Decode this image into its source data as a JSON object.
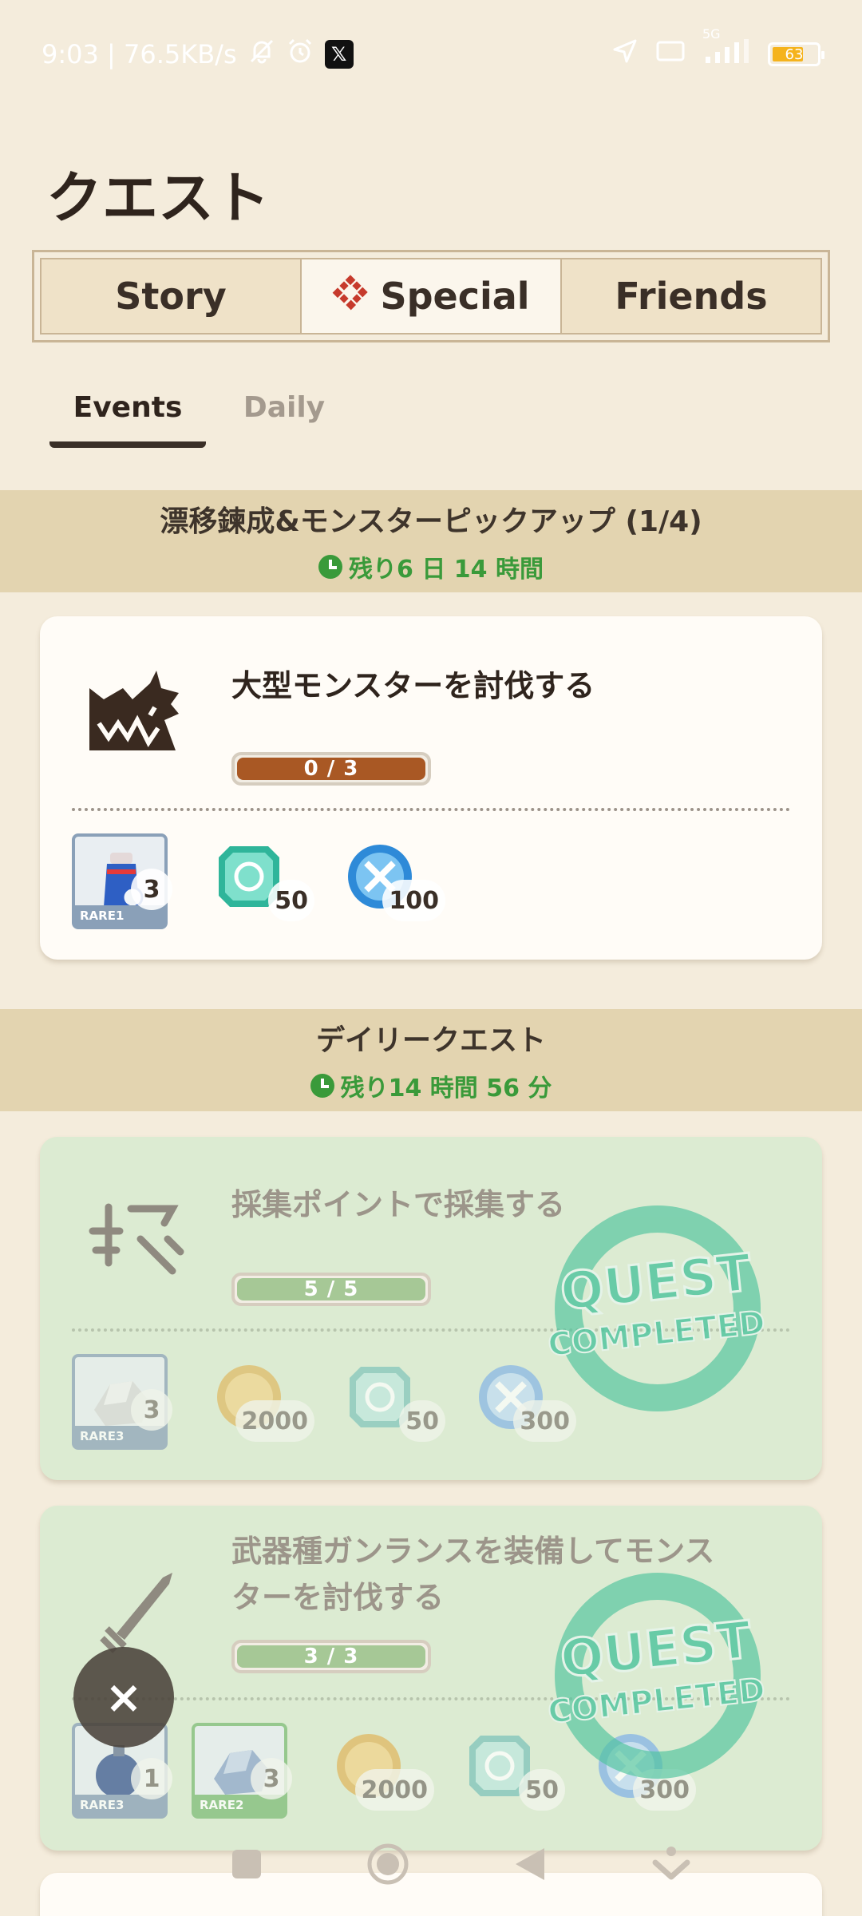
{
  "status_bar": {
    "time_speed": "9:03 | 76.5KB/s",
    "x_badge": "𝕏",
    "network_label": "5G",
    "battery_level": "63"
  },
  "page": {
    "title": "クエスト"
  },
  "top_tabs": [
    {
      "label": "Story",
      "active": false
    },
    {
      "label": "Special",
      "active": true
    },
    {
      "label": "Friends",
      "active": false
    }
  ],
  "sub_tabs": [
    {
      "label": "Events",
      "active": true
    },
    {
      "label": "Daily",
      "active": false
    }
  ],
  "event_section": {
    "title": "漂移鍊成&モンスターピックアップ (1/4)",
    "timer": "残り6 日 14 時間"
  },
  "daily_section": {
    "title": "デイリークエスト",
    "timer": "残り14 時間 56 分"
  },
  "quests": [
    {
      "title": "大型モンスターを討伐する",
      "progress_text": "0 / 3",
      "progress_fraction": 0,
      "completed": false,
      "rewards": [
        {
          "count": "3",
          "rare": "RARE1"
        },
        {
          "count": "50"
        },
        {
          "count": "100"
        }
      ]
    },
    {
      "title": "採集ポイントで採集する",
      "progress_text": "5 / 5",
      "progress_fraction": 1,
      "completed": true,
      "rewards": [
        {
          "count": "3",
          "rare": "RARE3"
        },
        {
          "count": "2000"
        },
        {
          "count": "50"
        },
        {
          "count": "300"
        }
      ]
    },
    {
      "title": "武器種ガンランスを装備してモンスターを討伐する",
      "progress_text": "3 / 3",
      "progress_fraction": 1,
      "completed": true,
      "rewards": [
        {
          "count": "1",
          "rare": "RARE3"
        },
        {
          "count": "3",
          "rare": "RARE2"
        },
        {
          "count": "2000"
        },
        {
          "count": "50"
        },
        {
          "count": "300"
        }
      ]
    }
  ],
  "stamp": {
    "line1": "QUEST",
    "line2": "COMPLETED"
  },
  "close_button": {
    "label": "×"
  },
  "colors": {
    "background": "#f4ecdc",
    "section_band": "#e3d4b0",
    "timer_green": "#3a9a3a",
    "progress_open": "#a95824",
    "progress_done": "#a6c896",
    "done_card": "#dcebd2",
    "stamp_green": "#4fc49e"
  }
}
